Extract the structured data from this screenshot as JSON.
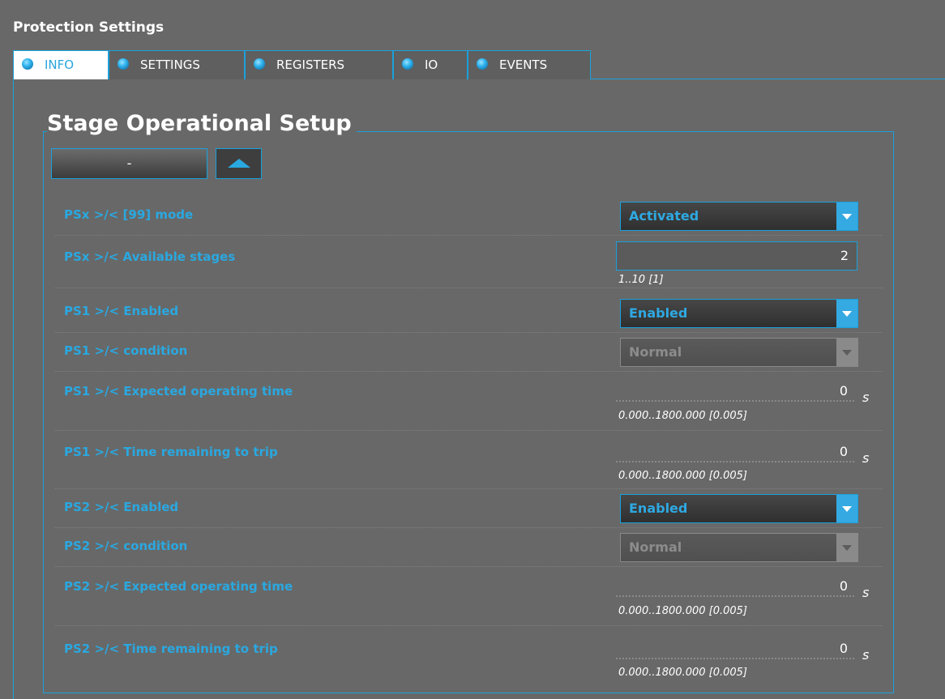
{
  "window": {
    "title": "Protection Settings"
  },
  "tabs": [
    {
      "label": "INFO",
      "active": true
    },
    {
      "label": "SETTINGS",
      "active": false
    },
    {
      "label": "REGISTERS",
      "active": false
    },
    {
      "label": "IO",
      "active": false
    },
    {
      "label": "EVENTS",
      "active": false
    }
  ],
  "section": {
    "title": "Stage Operational Setup",
    "stage_selector": "-"
  },
  "params": {
    "mode": {
      "label": "PSx >/< [99] mode",
      "value": "Activated"
    },
    "available_stages": {
      "label": "PSx >/< Available stages",
      "value": "2",
      "range": "1..10 [1]"
    },
    "ps1_enabled": {
      "label": "PS1 >/< Enabled",
      "value": "Enabled"
    },
    "ps1_condition": {
      "label": "PS1 >/< condition",
      "value": "Normal"
    },
    "ps1_expected_time": {
      "label": "PS1 >/< Expected operating time",
      "value": "0",
      "unit": "s",
      "range": "0.000..1800.000 [0.005]"
    },
    "ps1_time_remaining": {
      "label": "PS1 >/< Time remaining to trip",
      "value": "0",
      "unit": "s",
      "range": "0.000..1800.000 [0.005]"
    },
    "ps2_enabled": {
      "label": "PS2 >/< Enabled",
      "value": "Enabled"
    },
    "ps2_condition": {
      "label": "PS2 >/< condition",
      "value": "Normal"
    },
    "ps2_expected_time": {
      "label": "PS2 >/< Expected operating time",
      "value": "0",
      "unit": "s",
      "range": "0.000..1800.000 [0.005]"
    },
    "ps2_time_remaining": {
      "label": "PS2 >/< Time remaining to trip",
      "value": "0",
      "unit": "s",
      "range": "0.000..1800.000 [0.005]"
    }
  },
  "colors": {
    "accent": "#1aa1dc",
    "background": "#686868",
    "label": "#2aa8e0"
  }
}
